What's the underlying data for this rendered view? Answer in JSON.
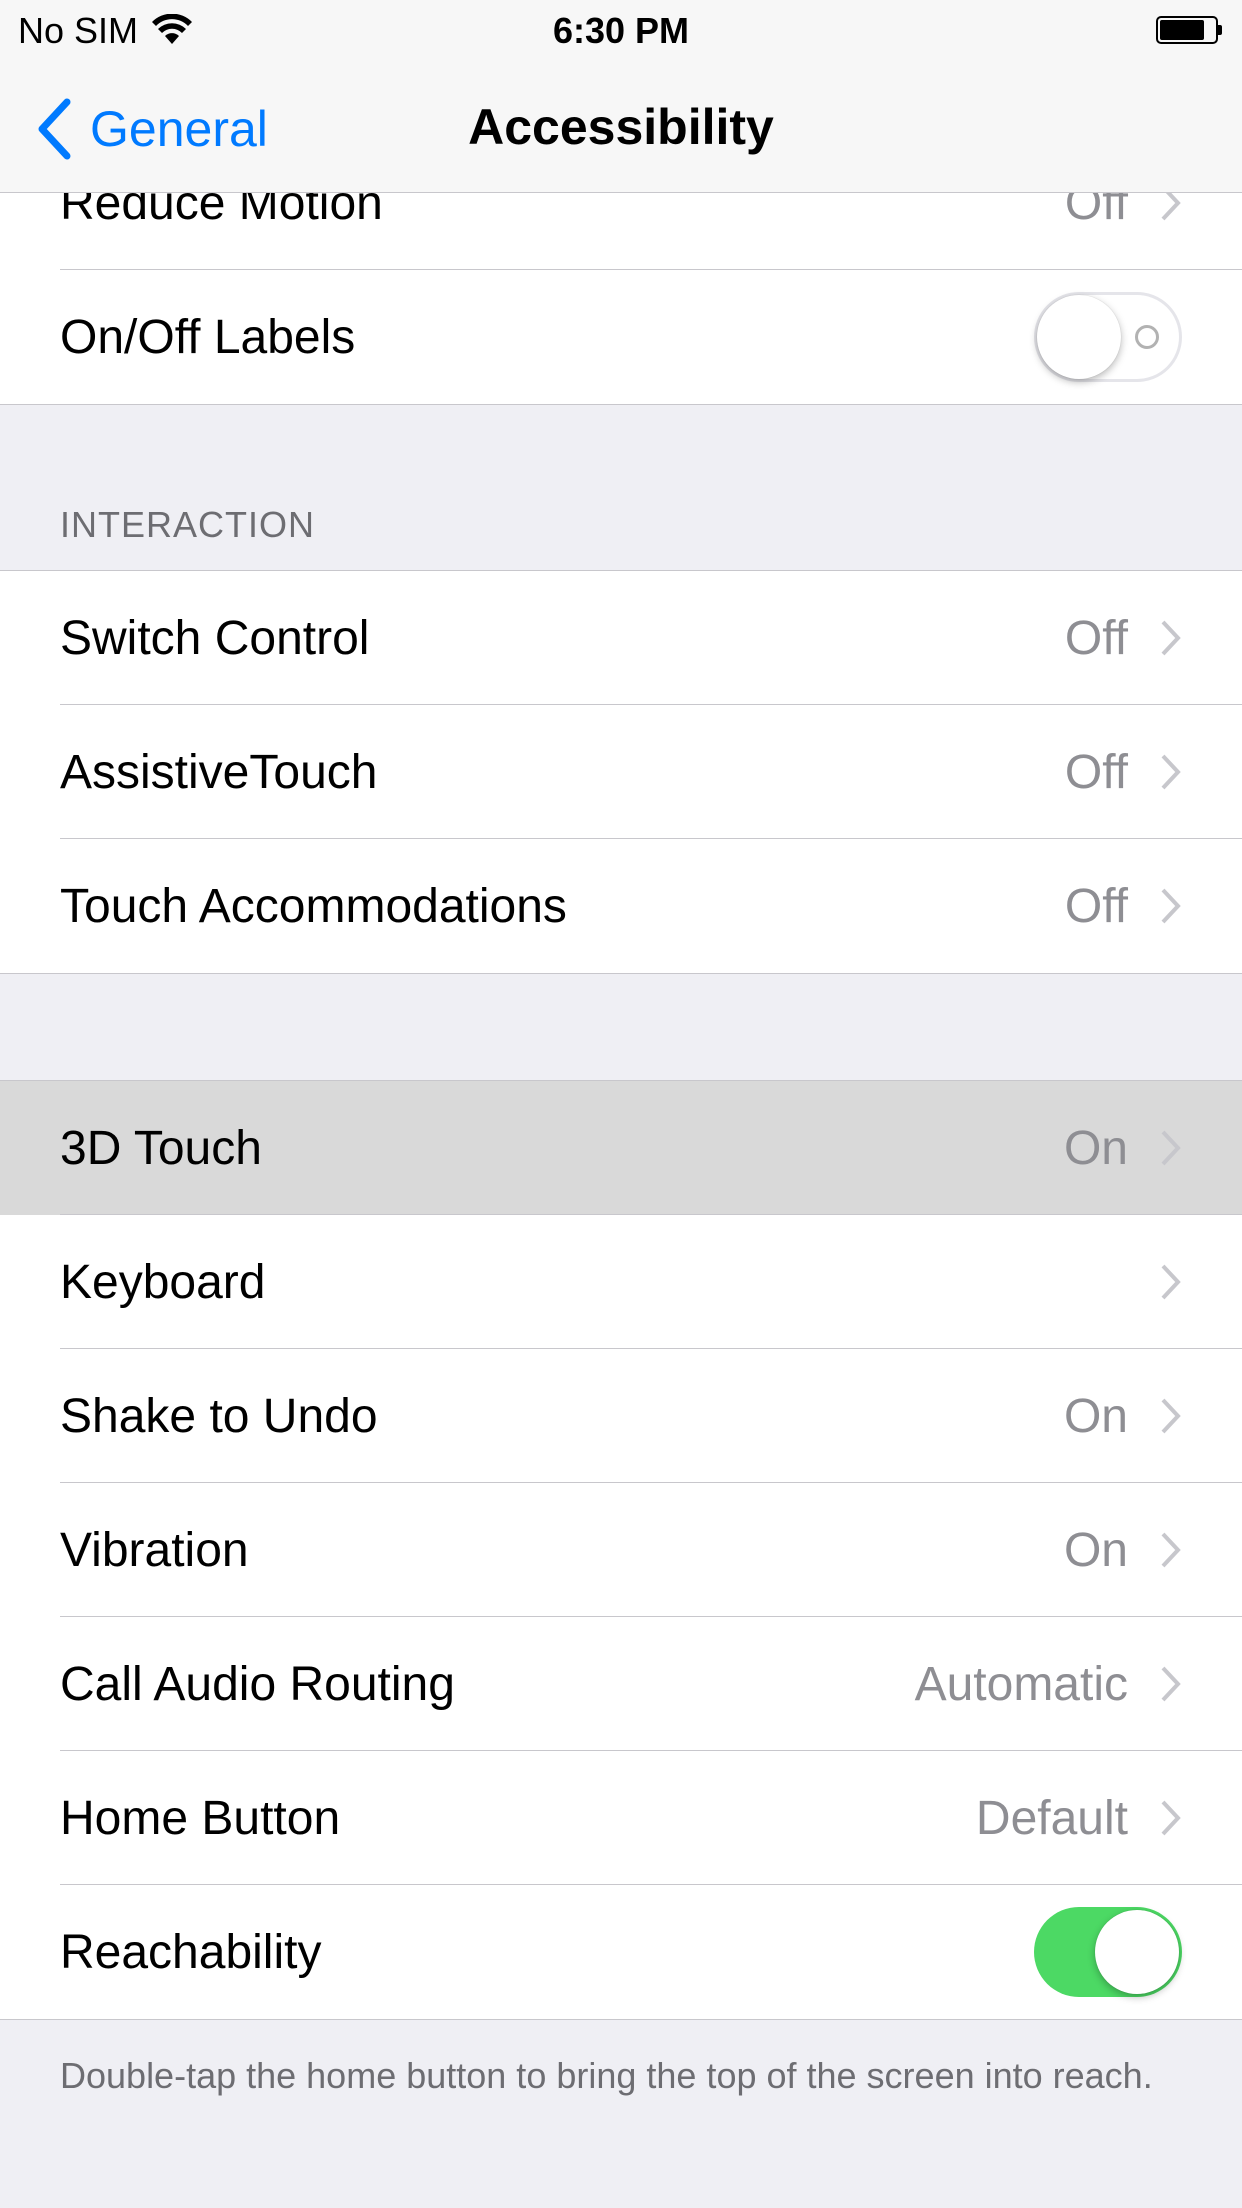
{
  "status_bar": {
    "carrier": "No SIM",
    "time": "6:30 PM"
  },
  "nav": {
    "back_label": "General",
    "title": "Accessibility"
  },
  "top_group": {
    "rows": [
      {
        "label": "Reduce Motion",
        "value": "Off"
      },
      {
        "label": "On/Off Labels",
        "toggle": "off"
      }
    ]
  },
  "interaction": {
    "header": "INTERACTION",
    "rows": [
      {
        "label": "Switch Control",
        "value": "Off"
      },
      {
        "label": "AssistiveTouch",
        "value": "Off"
      },
      {
        "label": "Touch Accommodations",
        "value": "Off"
      }
    ]
  },
  "main_group": {
    "rows": [
      {
        "label": "3D Touch",
        "value": "On",
        "highlighted": true
      },
      {
        "label": "Keyboard",
        "value": ""
      },
      {
        "label": "Shake to Undo",
        "value": "On"
      },
      {
        "label": "Vibration",
        "value": "On"
      },
      {
        "label": "Call Audio Routing",
        "value": "Automatic"
      },
      {
        "label": "Home Button",
        "value": "Default"
      },
      {
        "label": "Reachability",
        "toggle": "on"
      }
    ],
    "footer": "Double-tap the home button to bring the top of the screen into reach."
  },
  "colors": {
    "accent": "#007aff",
    "toggle_on": "#4cd964",
    "background": "#efeff4",
    "secondary_text": "#8e8e93"
  }
}
